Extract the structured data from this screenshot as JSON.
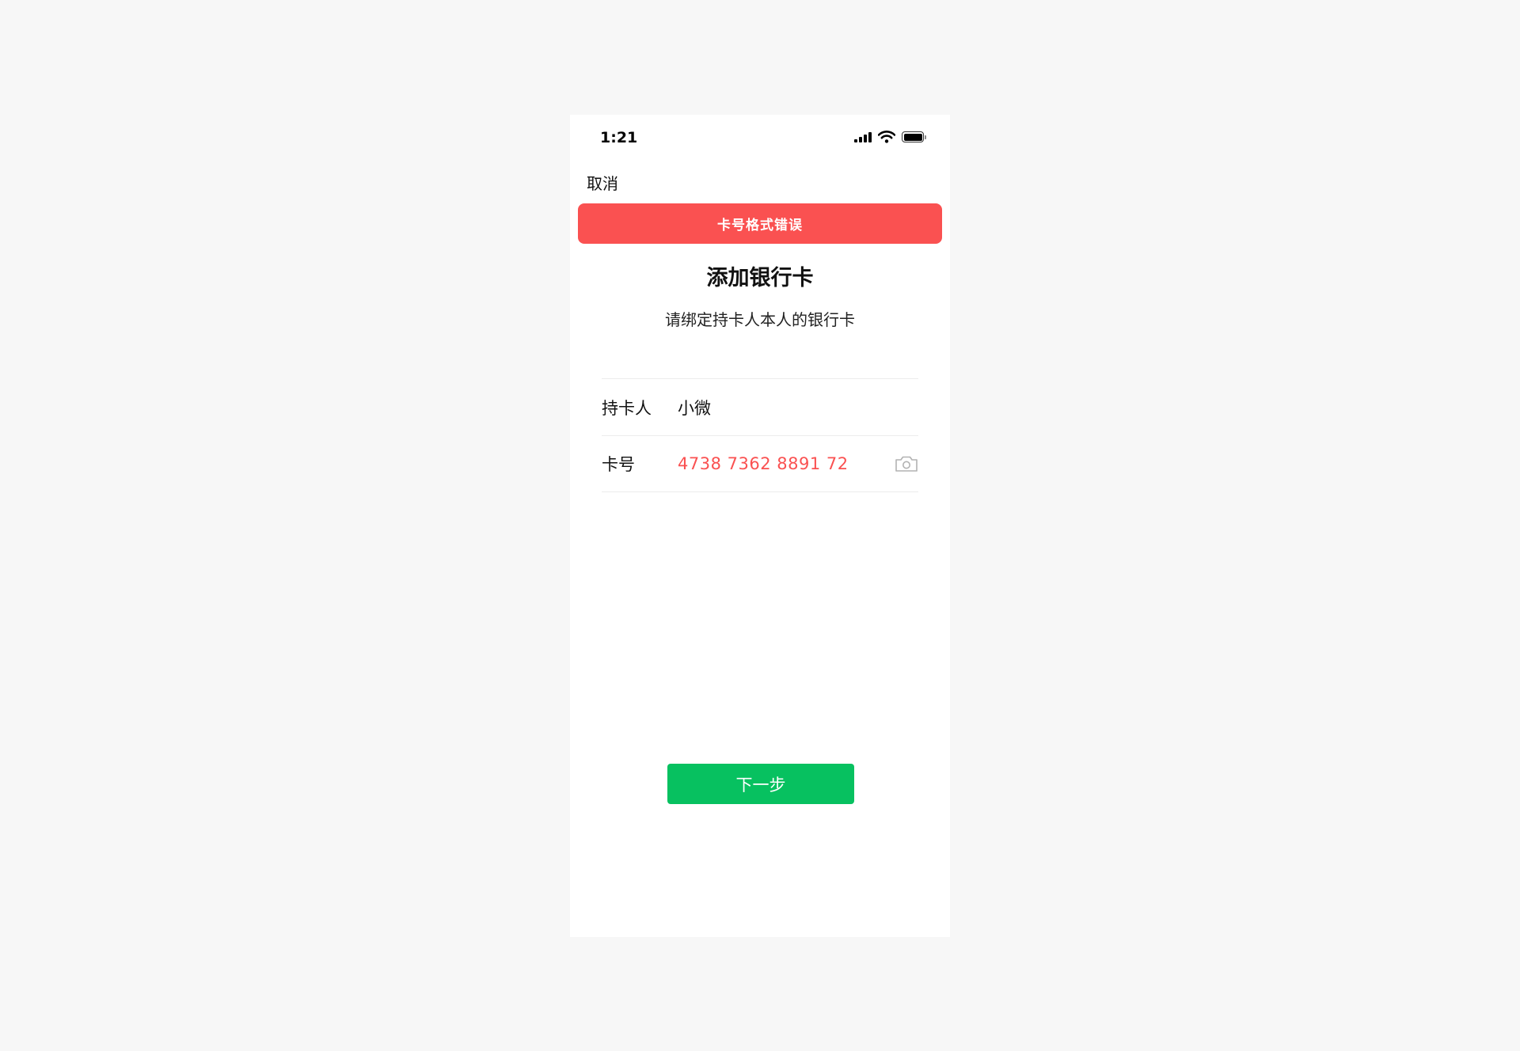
{
  "status_bar": {
    "time": "1:21",
    "icons": [
      "signal-icon",
      "wifi-icon",
      "battery-icon"
    ]
  },
  "nav": {
    "cancel_label": "取消"
  },
  "error_banner": {
    "text": "卡号格式错误",
    "color": "#fa5151"
  },
  "header": {
    "title": "添加银行卡",
    "subtitle": "请绑定持卡人本人的银行卡"
  },
  "form": {
    "cardholder": {
      "label": "持卡人",
      "value": "小微"
    },
    "card_number": {
      "label": "卡号",
      "value": "4738 7362 8891 72",
      "state": "error",
      "icon": "camera-icon"
    }
  },
  "actions": {
    "next_label": "下一步",
    "next_color": "#07c160"
  }
}
